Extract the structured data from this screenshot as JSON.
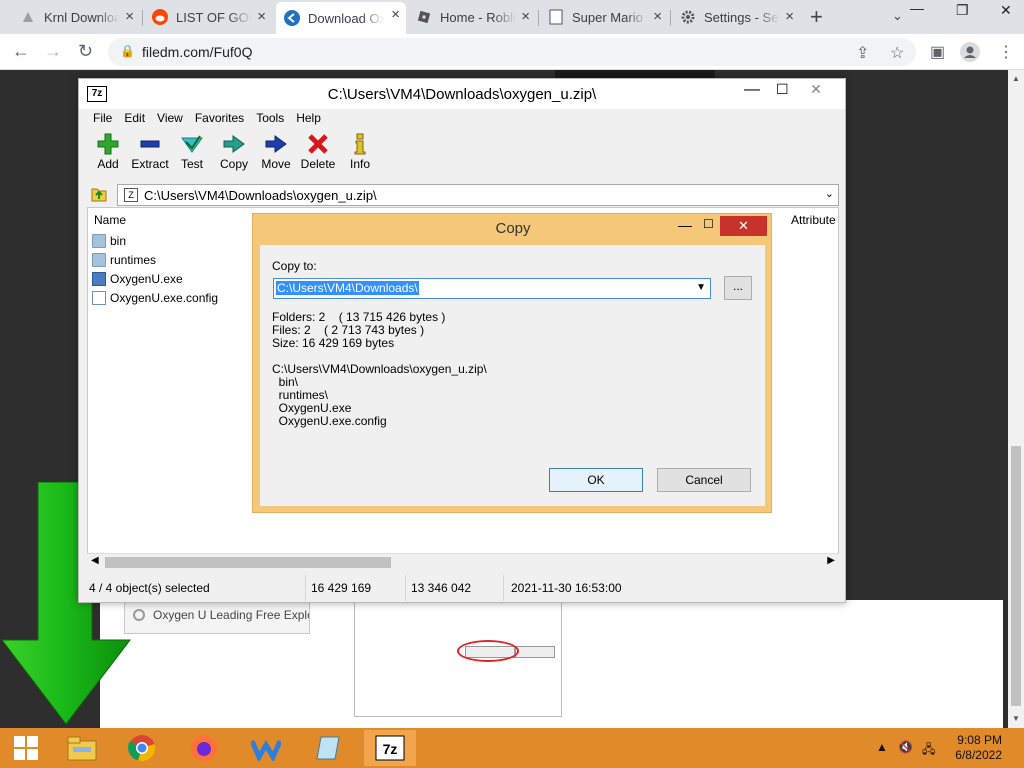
{
  "browser": {
    "tabs": [
      {
        "title": "Krnl Download",
        "icon": "krnl-icon"
      },
      {
        "title": "LIST OF GOOD",
        "icon": "reddit-icon"
      },
      {
        "title": "Download Oxygen",
        "icon": "download-site-icon",
        "active": true
      },
      {
        "title": "Home - Roblox",
        "icon": "roblox-icon"
      },
      {
        "title": "Super Mario",
        "icon": "page-icon"
      },
      {
        "title": "Settings - Security",
        "icon": "gear-icon"
      }
    ],
    "url": "filedm.com/Fuf0Q"
  },
  "page": {
    "download_button_label": "Oxygen U Leading Free Exploit"
  },
  "zip": {
    "title": "C:\\Users\\VM4\\Downloads\\oxygen_u.zip\\",
    "menu": [
      "File",
      "Edit",
      "View",
      "Favorites",
      "Tools",
      "Help"
    ],
    "toolbar": [
      "Add",
      "Extract",
      "Test",
      "Copy",
      "Move",
      "Delete",
      "Info"
    ],
    "address": "C:\\Users\\VM4\\Downloads\\oxygen_u.zip\\",
    "columns": {
      "name": "Name",
      "attributes": "Attribute"
    },
    "files": [
      {
        "name": "bin",
        "type": "folder"
      },
      {
        "name": "runtimes",
        "type": "folder"
      },
      {
        "name": "OxygenU.exe",
        "type": "exe"
      },
      {
        "name": "OxygenU.exe.config",
        "type": "config"
      }
    ],
    "status": {
      "selected": "4 / 4 object(s) selected",
      "size": "16 429 169",
      "packed": "13 346 042",
      "modified": "2021-11-30 16:53:00"
    }
  },
  "copy_dialog": {
    "title": "Copy",
    "copy_to_label": "Copy to:",
    "destination": "C:\\Users\\VM4\\Downloads\\",
    "browse_label": "...",
    "info": "Folders: 2    ( 13 715 426 bytes )\nFiles: 2    ( 2 713 743 bytes )\nSize: 16 429 169 bytes\n\nC:\\Users\\VM4\\Downloads\\oxygen_u.zip\\\n  bin\\\n  runtimes\\\n  OxygenU.exe\n  OxygenU.exe.config",
    "ok_label": "OK",
    "cancel_label": "Cancel"
  },
  "taskbar": {
    "time": "9:08 PM",
    "date": "6/8/2022"
  }
}
